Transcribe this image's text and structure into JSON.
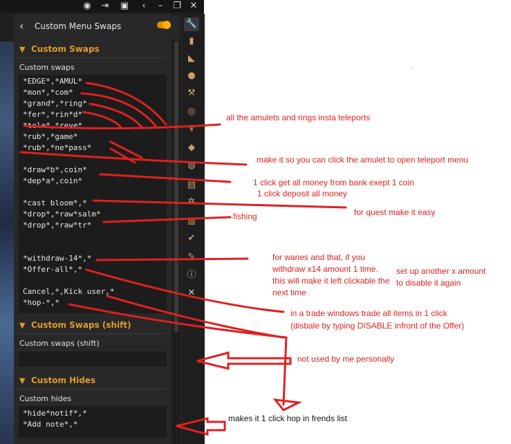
{
  "header": {
    "title": "Custom Menu Swaps"
  },
  "sections": [
    {
      "title": "Custom Swaps",
      "label": "Custom swaps",
      "lines": [
        "*EDGE*,*AMUL*",
        "*mon*,*com*",
        "*grand*,*ring*",
        "*fer*,*rin*d*",
        "*tele*,*reve*",
        "*rub*,*game*",
        "*rub*,*ne*pass*",
        "*draw*b*,coin*",
        "*dep*a*,coin*",
        "*cast bloom*,*",
        "*drop*,*raw*salm*",
        "*drop*,*raw*tr*",
        "*withdraw-14*,*",
        "*Offer-all*,*",
        "Cancel,*,Kick user,*",
        "*hop-*,*"
      ]
    },
    {
      "title": "Custom Swaps (shift)",
      "label": "Custom swaps (shift)",
      "lines": []
    },
    {
      "title": "Custom Hides",
      "label": "Custom hides",
      "lines": [
        "*hide*notif*,*",
        "*Add note*,*"
      ]
    }
  ],
  "annotations": {
    "amulets": "all the amulets and rings insta teleports",
    "teleport_menu": "make it so you can click the amulet to open teleport menu",
    "bank_get": "1 click get all money from bank exept 1 coin",
    "bank_deposit": "1 click deposit all money",
    "quest": "for quest make it easy",
    "fishing": "fishing",
    "wanes": "for wanes and that, if you withdraw x14 amount 1 time. this will make it left clickable the next time",
    "disable_again": "set up another x amount to disable it again",
    "trade_all": "in a trade windows trade all items in 1 click",
    "trade_disable": "(disbale by typing DISABLE infront of the Offer)",
    "not_used": "not used by me personally",
    "hop": "makes it 1 click hop in frends list"
  },
  "colors": {
    "accent": "#e09b2b",
    "annotation": "#e02020",
    "toggle": "#ffb000"
  },
  "icons": {
    "topbar": [
      "discord-icon",
      "exit-icon",
      "camera-icon",
      "back-icon",
      "minimize-icon",
      "restore-icon",
      "close-icon"
    ],
    "sidebar": [
      "wrench-icon",
      "stats-icon",
      "boot-icon",
      "globe-icon",
      "hammer-icon",
      "compass-icon",
      "trophy-icon",
      "rocks-icon",
      "bag-icon",
      "notes-icon",
      "map-pin-icon",
      "book-icon",
      "world-check-icon",
      "fish-icon",
      "info-icon",
      "crossed-swords-icon"
    ]
  }
}
